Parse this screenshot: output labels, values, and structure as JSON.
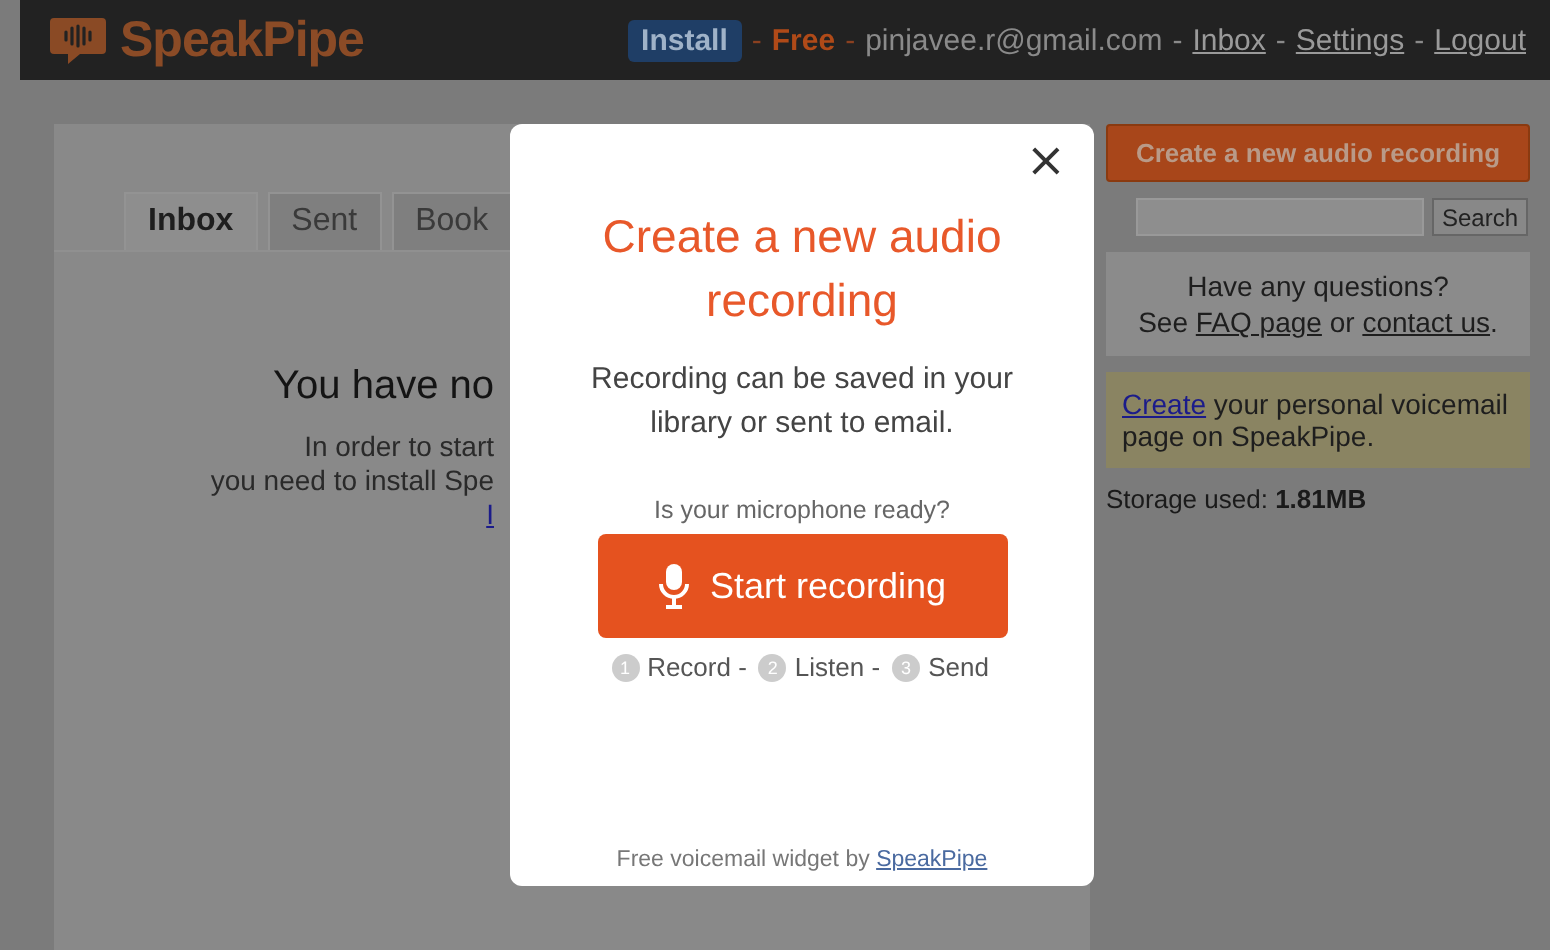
{
  "header": {
    "logo": "SpeakPipe",
    "items": [
      {
        "kind": "badge",
        "text": "Install"
      },
      {
        "kind": "separator",
        "text": "-"
      },
      {
        "kind": "plan",
        "text": "Free"
      },
      {
        "kind": "separator",
        "text": "-"
      },
      {
        "kind": "email",
        "text": "pinjavee.r@gmail.com"
      },
      {
        "kind": "separator",
        "text": "-"
      },
      {
        "kind": "link",
        "text": "Inbox"
      },
      {
        "kind": "separator",
        "text": "-"
      },
      {
        "kind": "link",
        "text": "Settings"
      },
      {
        "kind": "separator",
        "text": "-"
      },
      {
        "kind": "link",
        "text": "Logout"
      }
    ]
  },
  "tabs": [
    {
      "label": "Inbox",
      "selected": true
    },
    {
      "label": "Sent",
      "selected": false
    },
    {
      "label": "Book",
      "selected": false
    }
  ],
  "empty_state": {
    "heading": "You have no",
    "lines": [
      "In order to start",
      "you need to install Spe"
    ],
    "link": "I"
  },
  "sidebar": {
    "create_button": "Create a new audio recording",
    "search_button": "Search",
    "help": {
      "question": "Have any questions?",
      "see": "See",
      "faq": "FAQ page",
      "or": "or",
      "contact": "contact us",
      "end": "."
    },
    "promo": {
      "link": "Create",
      "text": "your personal voicemail page on SpeakPipe."
    },
    "storage_label": "Storage used:",
    "storage_value": "1.81MB"
  },
  "modal": {
    "title": "Create a new audio recording",
    "description": "Recording can be saved in your library or sent to email.",
    "question": "Is your microphone ready?",
    "button": "Start recording",
    "steps": [
      {
        "number": "1",
        "label": "Record -"
      },
      {
        "number": "2",
        "label": "Listen -"
      },
      {
        "number": "3",
        "label": "Send"
      }
    ],
    "close": "×",
    "footer": "Free voicemail widget by",
    "footer_link": "SpeakPipe"
  }
}
